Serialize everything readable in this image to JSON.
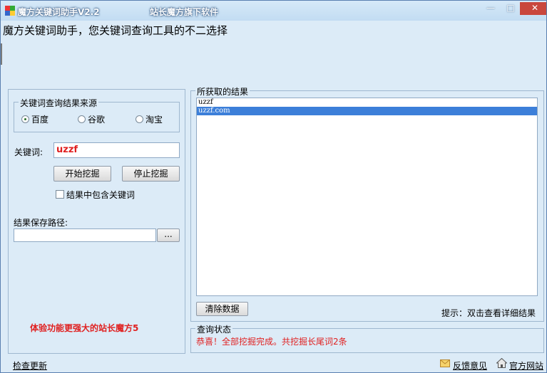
{
  "window": {
    "title": "魔方关键词助手V2.2",
    "vendor": "站长魔方旗下软件",
    "controls": {
      "minimize": "—",
      "maximize": "□",
      "close": "✕"
    }
  },
  "headline": "魔方关键词助手，您关键词查询工具的不二选择",
  "left_panel": {
    "source_group": {
      "label": "关键词查询结果来源",
      "options": [
        {
          "label": "百度",
          "selected": true
        },
        {
          "label": "谷歌",
          "selected": false
        },
        {
          "label": "淘宝",
          "selected": false
        }
      ]
    },
    "keyword_label": "关键词:",
    "keyword_value": "uzzf",
    "start_button": "开始挖掘",
    "stop_button": "停止挖掘",
    "include_keyword_label": "结果中包含关键词",
    "include_keyword_checked": false,
    "save_path_label": "结果保存路径:",
    "save_path_value": "",
    "browse_button": "...",
    "promo": "体验功能更强大的站长魔方5"
  },
  "results_panel": {
    "label": "所获取的结果",
    "items": [
      {
        "text": "uzzf",
        "selected": false
      },
      {
        "text": "uzzf.com",
        "selected": true
      }
    ],
    "clear_button": "清除数据",
    "hint": "提示：双击查看详细结果"
  },
  "status_panel": {
    "label": "查询状态",
    "text": "恭喜！全部挖掘完成。共挖掘长尾词2条"
  },
  "footer": {
    "check_update": "检查更新",
    "feedback": "反馈意见",
    "official_site": "官方网站"
  },
  "colors": {
    "title_bar": "#c2dcf2",
    "window_bg": "#dcebf7",
    "accent_red": "#e02020",
    "selection": "#3c7fd9",
    "close_button": "#c9473d"
  }
}
